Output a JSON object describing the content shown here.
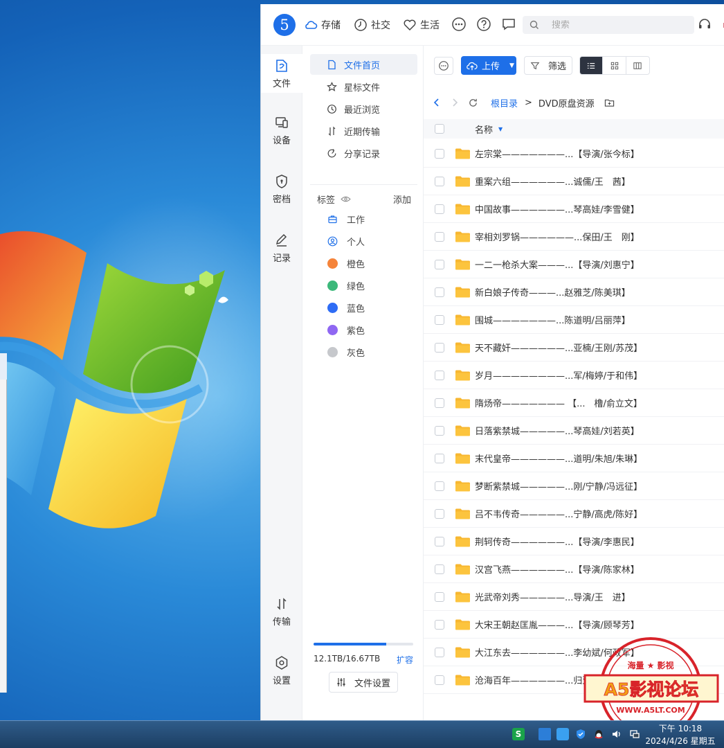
{
  "app": {
    "logo_text": "5",
    "nav": [
      "存储",
      "社交",
      "生活"
    ],
    "search_placeholder": "搜索",
    "right_edge_char": "ｒ"
  },
  "rail": [
    {
      "label": "文件",
      "icon": "file-icon",
      "active": true
    },
    {
      "label": "设备",
      "icon": "device-icon"
    },
    {
      "label": "密档",
      "icon": "shield-icon"
    },
    {
      "label": "记录",
      "icon": "edit-icon"
    },
    {
      "label": "传输",
      "icon": "transfer-icon"
    },
    {
      "label": "设置",
      "icon": "settings-icon"
    }
  ],
  "subnav": [
    {
      "label": "文件首页",
      "icon": "file-home-icon",
      "active": true
    },
    {
      "label": "星标文件",
      "icon": "star-icon"
    },
    {
      "label": "最近浏览",
      "icon": "history-icon"
    },
    {
      "label": "近期传输",
      "icon": "transfer-icon"
    },
    {
      "label": "分享记录",
      "icon": "share-icon"
    }
  ],
  "tags": {
    "title": "标签",
    "add": "添加",
    "items": [
      {
        "label": "工作",
        "icon": "briefcase-icon"
      },
      {
        "label": "个人",
        "icon": "person-icon"
      },
      {
        "label": "橙色",
        "color": "#f5843a"
      },
      {
        "label": "绿色",
        "color": "#3cb87a"
      },
      {
        "label": "蓝色",
        "color": "#2e6cf5"
      },
      {
        "label": "紫色",
        "color": "#8f67f2"
      },
      {
        "label": "灰色",
        "color": "#c6c8cc"
      }
    ]
  },
  "storage": {
    "used_fraction": 0.726,
    "text": "12.1TB/16.67TB",
    "expand": "扩容",
    "settings": "文件设置"
  },
  "toolbar": {
    "upload": "上传",
    "filter": "筛选"
  },
  "path": {
    "root": "根目录",
    "sep": ">",
    "current": "DVD原盘资源"
  },
  "list": {
    "header_name": "名称",
    "files": [
      "左宗棠———————...【导演/张今标】",
      "重案六组——————...诚儒/王　茜】",
      "中国故事——————...琴高娃/李雪健】",
      "宰相刘罗锅——————...保田/王　刚】",
      "一二一枪杀大案———...【导演/刘惠宁】",
      "新白娘子传奇———...赵雅芝/陈美琪】",
      "围城———————...陈道明/吕丽萍】",
      "天不藏奸——————...亚楠/王刚/苏茂】",
      "岁月————————...军/梅婷/于和伟】",
      "隋炀帝——————— 【...　橹/俞立文】",
      "日落紫禁城—————...琴高娃/刘若英】",
      "末代皇帝——————...道明/朱旭/朱琳】",
      "梦断紫禁城—————...刚/宁静/冯远征】",
      "吕不韦传奇—————...宁静/高虎/陈好】",
      "荆轲传奇——————...【导演/李惠民】",
      "汉宫飞燕——————...【导演/陈家林】",
      "光武帝刘秀—————...导演/王　进】",
      "大宋王朝赵匡胤———...【导演/顾琴芳】",
      "大江东去——————...李幼斌/何政军】",
      "沧海百年——————...归亚蕾/刘文治】"
    ]
  },
  "stamp": {
    "top_text": "海量 ★ 影视",
    "main_text": "A5影视论坛",
    "url": "WWW.A5LT.COM"
  },
  "taskbar": {
    "time": "下午 10:18",
    "date": "2024/4/26 星期五"
  }
}
